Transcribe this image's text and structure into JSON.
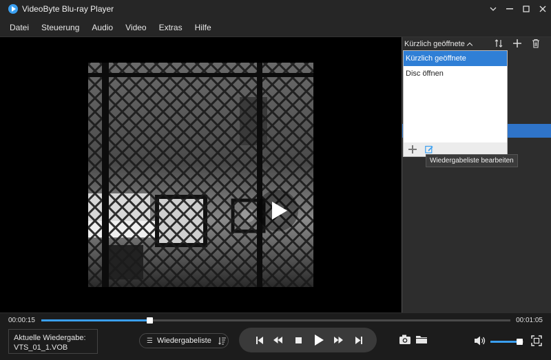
{
  "window": {
    "title": "VideoByte Blu-ray Player",
    "controls": [
      "chevron-down-icon",
      "minimize-icon",
      "maximize-icon",
      "close-icon"
    ]
  },
  "menu": {
    "items": [
      "Datei",
      "Steuerung",
      "Audio",
      "Video",
      "Extras",
      "Hilfe"
    ]
  },
  "playlist_panel": {
    "header_label": "Kürzlich geöffnete",
    "header_icons": [
      "sort-icon",
      "add-icon",
      "delete-icon"
    ],
    "dropdown_items": [
      {
        "label": "Kürzlich geöffnete",
        "active": true
      },
      {
        "label": "Disc öffnen",
        "active": false
      }
    ],
    "footer_icons": [
      "add-icon",
      "edit-icon"
    ],
    "tooltip": "Wiedergabeliste bearbeiten"
  },
  "playback": {
    "current_time": "00:00:15",
    "total_time": "00:01:05",
    "progress_fraction": 0.23,
    "volume_fraction": 0.88
  },
  "now_playing": {
    "label": "Aktuelle Wiedergabe:",
    "file": "VTS_01_1.VOB"
  },
  "playlist_button": {
    "label": "Wiedergabeliste"
  },
  "colors": {
    "accent": "#3a9ff0",
    "selection": "#2f7fd6",
    "background": "#1f1f1f"
  }
}
